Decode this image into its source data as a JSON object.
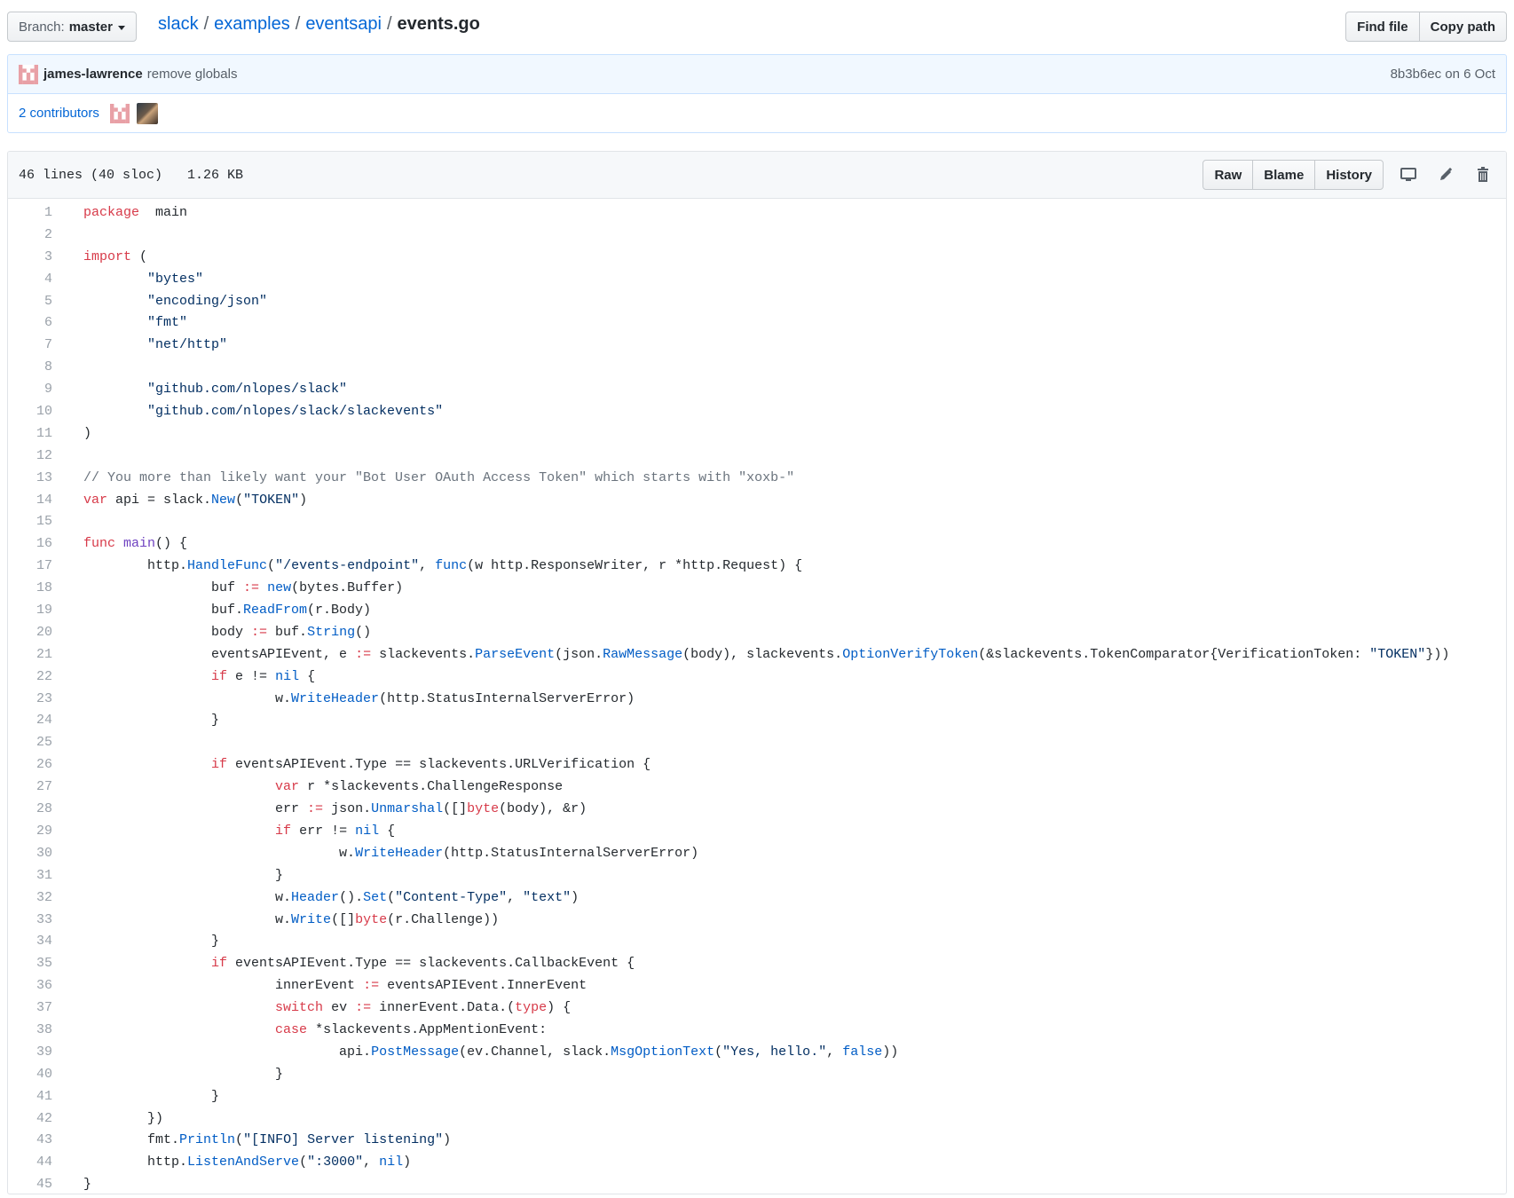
{
  "header": {
    "branch_label": "Branch:",
    "branch_value": "master",
    "breadcrumb": [
      "slack",
      "examples",
      "eventsapi"
    ],
    "filename": "events.go",
    "find_file": "Find file",
    "copy_path": "Copy path"
  },
  "commit": {
    "author": "james-lawrence",
    "message": "remove globals",
    "sha_date": "8b3b6ec on 6 Oct"
  },
  "contributors": {
    "label": "2 contributors"
  },
  "file": {
    "lines_info": "46 lines (40 sloc)",
    "size": "1.26 KB",
    "raw": "Raw",
    "blame": "Blame",
    "history": "History"
  },
  "code": [
    [
      [
        "k",
        "package"
      ],
      [
        "",
        "  main"
      ]
    ],
    [],
    [
      [
        "k",
        "import"
      ],
      [
        "",
        " ("
      ]
    ],
    [
      [
        "",
        "\t"
      ],
      [
        "s",
        "\"bytes\""
      ]
    ],
    [
      [
        "",
        "\t"
      ],
      [
        "s",
        "\"encoding/json\""
      ]
    ],
    [
      [
        "",
        "\t"
      ],
      [
        "s",
        "\"fmt\""
      ]
    ],
    [
      [
        "",
        "\t"
      ],
      [
        "s",
        "\"net/http\""
      ]
    ],
    [],
    [
      [
        "",
        "\t"
      ],
      [
        "s",
        "\"github.com/nlopes/slack\""
      ]
    ],
    [
      [
        "",
        "\t"
      ],
      [
        "s",
        "\"github.com/nlopes/slack/slackevents\""
      ]
    ],
    [
      [
        "",
        ")"
      ]
    ],
    [],
    [
      [
        "c",
        "// You more than likely want your \"Bot User OAuth Access Token\" which starts with \"xoxb-\""
      ]
    ],
    [
      [
        "k",
        "var"
      ],
      [
        "",
        " api = slack."
      ],
      [
        "f",
        "New"
      ],
      [
        "",
        "("
      ],
      [
        "s",
        "\"TOKEN\""
      ],
      [
        "",
        ")"
      ]
    ],
    [],
    [
      [
        "k",
        "func"
      ],
      [
        "",
        " "
      ],
      [
        "p",
        "main"
      ],
      [
        "",
        "() {"
      ]
    ],
    [
      [
        "",
        "\thttp."
      ],
      [
        "f",
        "HandleFunc"
      ],
      [
        "",
        "("
      ],
      [
        "s",
        "\"/events-endpoint\""
      ],
      [
        "",
        ", "
      ],
      [
        "f",
        "func"
      ],
      [
        "",
        "(w http.ResponseWriter, r *http.Request) {"
      ]
    ],
    [
      [
        "",
        "\t\tbuf "
      ],
      [
        "k",
        ":="
      ],
      [
        "",
        " "
      ],
      [
        "f",
        "new"
      ],
      [
        "",
        "(bytes.Buffer)"
      ]
    ],
    [
      [
        "",
        "\t\tbuf."
      ],
      [
        "f",
        "ReadFrom"
      ],
      [
        "",
        "(r.Body)"
      ]
    ],
    [
      [
        "",
        "\t\tbody "
      ],
      [
        "k",
        ":="
      ],
      [
        "",
        " buf."
      ],
      [
        "f",
        "String"
      ],
      [
        "",
        "()"
      ]
    ],
    [
      [
        "",
        "\t\teventsAPIEvent, e "
      ],
      [
        "k",
        ":="
      ],
      [
        "",
        " slackevents."
      ],
      [
        "f",
        "ParseEvent"
      ],
      [
        "",
        "(json."
      ],
      [
        "f",
        "RawMessage"
      ],
      [
        "",
        "(body), slackevents."
      ],
      [
        "f",
        "OptionVerifyToken"
      ],
      [
        "",
        "(&slackevents.TokenComparator{VerificationToken: "
      ],
      [
        "s",
        "\"TOKEN\""
      ],
      [
        "",
        "}))"
      ]
    ],
    [
      [
        "",
        "\t\t"
      ],
      [
        "k",
        "if"
      ],
      [
        "",
        " e != "
      ],
      [
        "f",
        "nil"
      ],
      [
        "",
        " {"
      ]
    ],
    [
      [
        "",
        "\t\t\tw."
      ],
      [
        "f",
        "WriteHeader"
      ],
      [
        "",
        "(http.StatusInternalServerError)"
      ]
    ],
    [
      [
        "",
        "\t\t}"
      ]
    ],
    [],
    [
      [
        "",
        "\t\t"
      ],
      [
        "k",
        "if"
      ],
      [
        "",
        " eventsAPIEvent.Type == slackevents.URLVerification {"
      ]
    ],
    [
      [
        "",
        "\t\t\t"
      ],
      [
        "k",
        "var"
      ],
      [
        "",
        " r *slackevents.ChallengeResponse"
      ]
    ],
    [
      [
        "",
        "\t\t\terr "
      ],
      [
        "k",
        ":="
      ],
      [
        "",
        " json."
      ],
      [
        "f",
        "Unmarshal"
      ],
      [
        "",
        "([]"
      ],
      [
        "k",
        "byte"
      ],
      [
        "",
        "(body), &r)"
      ]
    ],
    [
      [
        "",
        "\t\t\t"
      ],
      [
        "k",
        "if"
      ],
      [
        "",
        " err != "
      ],
      [
        "f",
        "nil"
      ],
      [
        "",
        " {"
      ]
    ],
    [
      [
        "",
        "\t\t\t\tw."
      ],
      [
        "f",
        "WriteHeader"
      ],
      [
        "",
        "(http.StatusInternalServerError)"
      ]
    ],
    [
      [
        "",
        "\t\t\t}"
      ]
    ],
    [
      [
        "",
        "\t\t\tw."
      ],
      [
        "f",
        "Header"
      ],
      [
        "",
        "()."
      ],
      [
        "f",
        "Set"
      ],
      [
        "",
        "("
      ],
      [
        "s",
        "\"Content-Type\""
      ],
      [
        "",
        ", "
      ],
      [
        "s",
        "\"text\""
      ],
      [
        "",
        ")"
      ]
    ],
    [
      [
        "",
        "\t\t\tw."
      ],
      [
        "f",
        "Write"
      ],
      [
        "",
        "([]"
      ],
      [
        "k",
        "byte"
      ],
      [
        "",
        "(r.Challenge))"
      ]
    ],
    [
      [
        "",
        "\t\t}"
      ]
    ],
    [
      [
        "",
        "\t\t"
      ],
      [
        "k",
        "if"
      ],
      [
        "",
        " eventsAPIEvent.Type == slackevents.CallbackEvent {"
      ]
    ],
    [
      [
        "",
        "\t\t\tinnerEvent "
      ],
      [
        "k",
        ":="
      ],
      [
        "",
        " eventsAPIEvent.InnerEvent"
      ]
    ],
    [
      [
        "",
        "\t\t\t"
      ],
      [
        "k",
        "switch"
      ],
      [
        "",
        " ev "
      ],
      [
        "k",
        ":="
      ],
      [
        "",
        " innerEvent.Data.("
      ],
      [
        "k",
        "type"
      ],
      [
        "",
        ") {"
      ]
    ],
    [
      [
        "",
        "\t\t\t"
      ],
      [
        "k",
        "case"
      ],
      [
        "",
        " *slackevents.AppMentionEvent:"
      ]
    ],
    [
      [
        "",
        "\t\t\t\tapi."
      ],
      [
        "f",
        "PostMessage"
      ],
      [
        "",
        "(ev.Channel, slack."
      ],
      [
        "f",
        "MsgOptionText"
      ],
      [
        "",
        "("
      ],
      [
        "s",
        "\"Yes, hello.\""
      ],
      [
        "",
        ", "
      ],
      [
        "f",
        "false"
      ],
      [
        "",
        "))"
      ]
    ],
    [
      [
        "",
        "\t\t\t}"
      ]
    ],
    [
      [
        "",
        "\t\t}"
      ]
    ],
    [
      [
        "",
        "\t})"
      ]
    ],
    [
      [
        "",
        "\tfmt."
      ],
      [
        "f",
        "Println"
      ],
      [
        "",
        "("
      ],
      [
        "s",
        "\"[INFO] Server listening\""
      ],
      [
        "",
        ")"
      ]
    ],
    [
      [
        "",
        "\thttp."
      ],
      [
        "f",
        "ListenAndServe"
      ],
      [
        "",
        "("
      ],
      [
        "s",
        "\":3000\""
      ],
      [
        "",
        ", "
      ],
      [
        "f",
        "nil"
      ],
      [
        "",
        ")"
      ]
    ],
    [
      [
        "",
        "}"
      ]
    ]
  ]
}
